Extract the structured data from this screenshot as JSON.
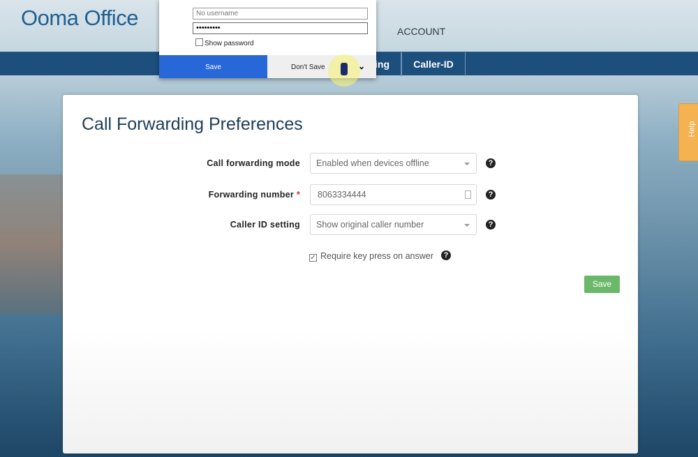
{
  "header": {
    "logo": "Ooma Office",
    "account": "ACCOUNT"
  },
  "nav": {
    "tabs": [
      {
        "label": "ing"
      },
      {
        "label": "Caller-ID"
      }
    ]
  },
  "page": {
    "title": "Call Forwarding Preferences",
    "fields": [
      {
        "label": "Call forwarding mode",
        "value": "Enabled when devices offline",
        "type": "select"
      },
      {
        "label": "Forwarding number",
        "required": "*",
        "value": "8063334444",
        "type": "text"
      },
      {
        "label": "Caller ID setting",
        "value": "Show original caller number",
        "type": "select"
      }
    ],
    "checkbox": {
      "label": "Require key press on answer",
      "checked": true
    },
    "save": "Save",
    "help_glyph": "?"
  },
  "help_tab": "Help",
  "password_popup": {
    "username_placeholder": "No username",
    "password": "•••••••••",
    "show_password": "Show password",
    "save": "Save",
    "dont_save": "Don't Save"
  }
}
